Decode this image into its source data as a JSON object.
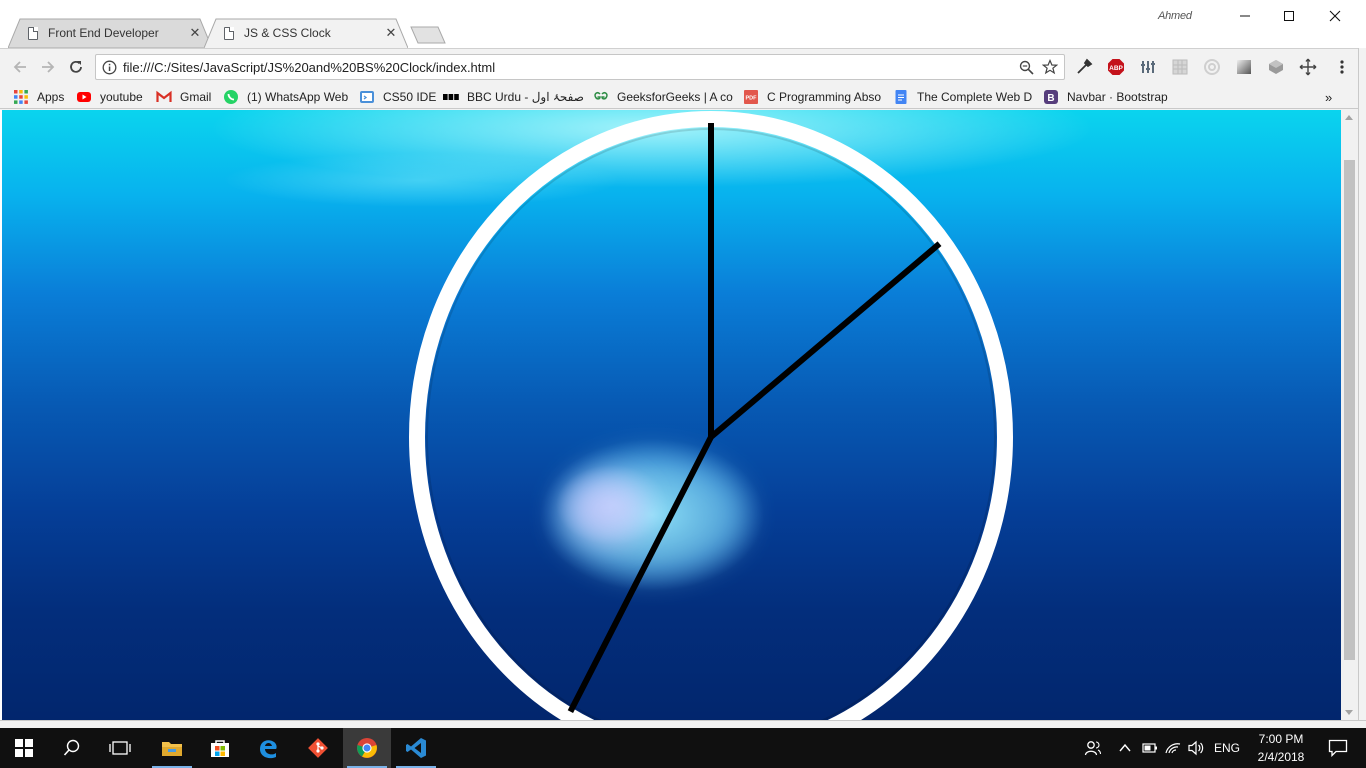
{
  "browser": {
    "tabs": [
      {
        "title": "Front End Developer",
        "active": false
      },
      {
        "title": "JS & CSS Clock",
        "active": true
      }
    ],
    "profile_name": "Ahmed",
    "window_controls": {
      "minimize": "—",
      "maximize": "☐",
      "close": "✕"
    },
    "address_bar": {
      "url": "file:///C:/Sites/JavaScript/JS%20and%20BS%20Clock/index.html"
    },
    "bookmarks": [
      {
        "label": "Apps",
        "icon": "apps-grid-icon",
        "color": "#e8453c"
      },
      {
        "label": "youtube",
        "icon": "youtube-icon",
        "color": "#ff0000"
      },
      {
        "label": "Gmail",
        "icon": "gmail-icon",
        "color": "#d93025"
      },
      {
        "label": "(1) WhatsApp Web",
        "icon": "whatsapp-icon",
        "color": "#25d366"
      },
      {
        "label": "CS50 IDE",
        "icon": "cs50-icon",
        "color": "#4a90d9"
      },
      {
        "label": "BBC Urdu - صفحۂ اول",
        "icon": "bbc-icon",
        "color": "#000000"
      },
      {
        "label": "GeeksforGeeks | A co",
        "icon": "geeksforgeeks-icon",
        "color": "#2f8d46"
      },
      {
        "label": "C Programming Abso",
        "icon": "pdf-icon",
        "color": "#e2574c"
      },
      {
        "label": "The Complete Web D",
        "icon": "google-docs-icon",
        "color": "#4285f4"
      },
      {
        "label": "Navbar · Bootstrap",
        "icon": "bootstrap-icon",
        "color": "#563d7c"
      }
    ],
    "bookmarks_overflow": "»"
  },
  "page": {
    "clock": {
      "hour_hand_angle_deg": 0,
      "minute_hand_angle_deg": 52,
      "second_hand_angle_deg": 209,
      "hand_color": "#000000",
      "face_border_color": "#ffffff"
    }
  },
  "taskbar": {
    "apps": [
      "windows-start-icon",
      "search-icon",
      "task-view-icon",
      "file-explorer-icon",
      "store-icon",
      "edge-icon",
      "git-icon",
      "chrome-icon",
      "vscode-icon"
    ],
    "active_app": "chrome-icon",
    "language": "ENG",
    "time": "7:00 PM",
    "date": "2/4/2018"
  }
}
